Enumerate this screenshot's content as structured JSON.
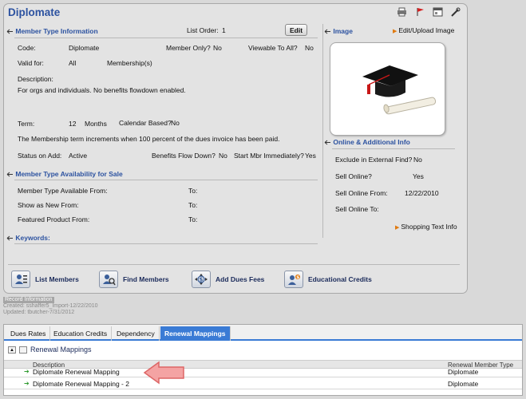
{
  "header": {
    "title": "Diplomate"
  },
  "toolbar_icons": [
    "printer-icon",
    "flag-icon",
    "window-icon",
    "tools-icon"
  ],
  "member_type": {
    "section_title": "Member Type Information",
    "list_order_label": "List Order:",
    "list_order_value": "1",
    "edit_label": "Edit",
    "code_label": "Code:",
    "code_value": "Diplomate",
    "member_only_label": "Member Only?",
    "member_only_value": "No",
    "viewable_label": "Viewable To All?",
    "viewable_value": "No",
    "valid_for_label": "Valid for:",
    "valid_for_value": "All",
    "valid_for_unit": "Membership(s)",
    "description_label": "Description:",
    "description_value": "For orgs and individuals. No benefits flowdown enabled.",
    "term_label": "Term:",
    "term_value": "12",
    "term_unit": "Months",
    "calendar_label": "Calendar Based?",
    "calendar_value": "No",
    "term_note_pre": "The Membership term increments when",
    "term_note_value": "100",
    "term_note_post": "percent of the dues invoice has been paid.",
    "status_label": "Status on Add:",
    "status_value": "Active",
    "benefits_label": "Benefits Flow Down?",
    "benefits_value": "No",
    "start_mbr_label": "Start Mbr Immediately?",
    "start_mbr_value": "Yes"
  },
  "image_section": {
    "title": "Image",
    "upload_link": "Edit/Upload Image"
  },
  "online": {
    "title": "Online & Additional Info",
    "exclude_label": "Exclude in External Find?",
    "exclude_value": "No",
    "sell_online_label": "Sell Online?",
    "sell_online_value": "Yes",
    "sell_from_label": "Sell Online From:",
    "sell_from_value": "12/22/2010",
    "sell_to_label": "Sell Online To:",
    "sell_to_value": "",
    "shopping_link": "Shopping Text Info"
  },
  "availability": {
    "title": "Member Type Availability for Sale",
    "rows": [
      {
        "label": "Member Type Available From:",
        "to_label": "To:"
      },
      {
        "label": "Show as New From:",
        "to_label": "To:"
      },
      {
        "label": "Featured Product From:",
        "to_label": "To:"
      }
    ]
  },
  "keywords": {
    "title": "Keywords:"
  },
  "actions": {
    "list_members": "List Members",
    "find_members": "Find Members",
    "add_dues": "Add Dues Fees",
    "edu_credits": "Educational Credits"
  },
  "record_info": {
    "header": "Record Information",
    "created": "Created: sshaffer5_Import-12/22/2010",
    "updated": "Updated: tbutcher-7/31/2012"
  },
  "tabs": [
    "Dues Rates",
    "Education Credits",
    "Dependency",
    "Renewal Mappings"
  ],
  "active_tab": "Renewal Mappings",
  "grid": {
    "title": "Renewal Mappings",
    "col_description": "Description",
    "col_type": "Renewal Member Type",
    "rows": [
      {
        "description": "Diplomate Renewal Mapping",
        "type": "Diplomate"
      },
      {
        "description": "Diplomate Renewal Mapping - 2",
        "type": "Diplomate"
      }
    ]
  },
  "colors": {
    "title_blue": "#2c52a0",
    "tab_active": "#3a7bd5",
    "callout_arrow": "#f4a3a3",
    "link_arrow": "#e07a10",
    "row_arrow": "#2e9a2e"
  }
}
